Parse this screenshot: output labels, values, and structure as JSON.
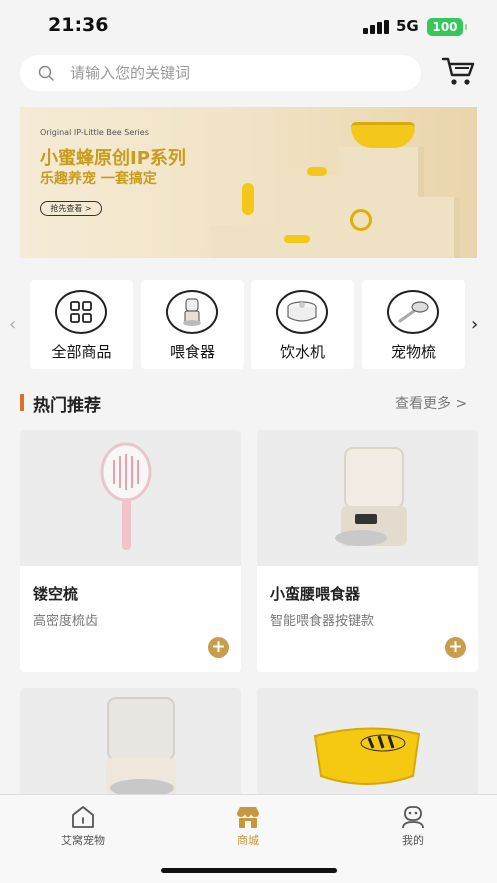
{
  "status_bar": {
    "time": "21:36",
    "network": "5G",
    "battery": "100"
  },
  "search": {
    "placeholder": "请输入您的关键词",
    "icon": "search-icon"
  },
  "cart": {
    "icon": "cart-icon"
  },
  "banner": {
    "subtitle": "Original IP-Little Bee Series",
    "title": "小蜜蜂原创IP系列",
    "tagline": "乐趣养宠 一套搞定",
    "button_label": "抢先查看 >"
  },
  "categories": {
    "items": [
      {
        "label": "全部商品",
        "icon": "grid-icon"
      },
      {
        "label": "喂食器",
        "icon": "feeder-icon"
      },
      {
        "label": "饮水机",
        "icon": "water-fountain-icon"
      },
      {
        "label": "宠物梳",
        "icon": "comb-icon"
      }
    ]
  },
  "hot": {
    "title": "热门推荐",
    "more_label": "查看更多 >"
  },
  "products": [
    {
      "name": "镂空梳",
      "desc": "高密度梳齿"
    },
    {
      "name": "小蛮腰喂食器",
      "desc": "智能喂食器按键款"
    }
  ],
  "tabbar": {
    "items": [
      {
        "label": "艾窝宠物",
        "icon": "home-icon"
      },
      {
        "label": "商城",
        "icon": "shop-icon"
      },
      {
        "label": "我的",
        "icon": "profile-icon"
      }
    ]
  },
  "colors": {
    "accent": "#c8963e",
    "hot_bar": "#dd6f2a",
    "banner_title": "#c99c1b",
    "plus": "#c89d4c"
  }
}
